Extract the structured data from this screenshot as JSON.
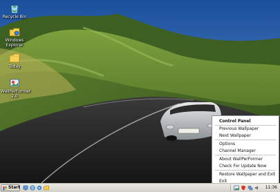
{
  "desktop": {
    "icons": [
      {
        "label": "Recycle Bin",
        "icon": "recycle-bin-icon"
      },
      {
        "label": "Windows Explorer",
        "icon": "windows-explorer-icon"
      },
      {
        "label": "Today",
        "icon": "folder-icon"
      },
      {
        "label": "WallPerFormer 2.0",
        "icon": "wallperformer-icon"
      }
    ]
  },
  "context_menu": {
    "header": "Control Panel",
    "items": [
      "Previous Wallpaper",
      "Next Wallpaper",
      "Options",
      "Channel Manager",
      "About WallPerFormer",
      "Check For Update Now",
      "Restore Wallpaper and Exit",
      "Exit"
    ]
  },
  "taskbar": {
    "start_label": "Start",
    "clock": "11:36"
  },
  "colors": {
    "menu_bg": "#ffffff",
    "taskbar_bg": "#dedbd1"
  }
}
